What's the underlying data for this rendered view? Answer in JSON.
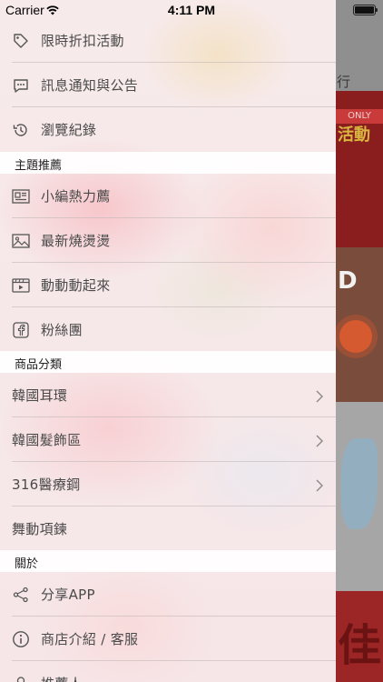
{
  "status_bar": {
    "carrier": "Carrier",
    "time": "4:11 PM"
  },
  "background": {
    "tab_fragment": "行",
    "banner_only": "ONLY",
    "banner_event": "活動",
    "banner_letter": "D",
    "banner_big_char": "佳"
  },
  "menu_top": [
    {
      "label": "限時折扣活動",
      "icon": "tag-icon"
    },
    {
      "label": "訊息通知與公告",
      "icon": "message-icon"
    },
    {
      "label": "瀏覽紀錄",
      "icon": "history-icon"
    }
  ],
  "section_themes": {
    "title": "主題推薦",
    "items": [
      {
        "label": "小編熱力薦",
        "icon": "newspaper-icon"
      },
      {
        "label": "最新燒燙燙",
        "icon": "image-icon"
      },
      {
        "label": "動動動起來",
        "icon": "video-icon"
      },
      {
        "label": "粉絲團",
        "icon": "facebook-icon"
      }
    ]
  },
  "section_categories": {
    "title": "商品分類",
    "items": [
      {
        "label": "韓國耳環",
        "has_chevron": true
      },
      {
        "label": "韓國髮飾區",
        "has_chevron": true
      },
      {
        "label": "316醫療鋼",
        "has_chevron": true
      },
      {
        "label": "舞動項鍊",
        "has_chevron": false
      }
    ]
  },
  "section_about": {
    "title": "關於",
    "items": [
      {
        "label": "分享APP",
        "icon": "share-icon"
      },
      {
        "label": "商店介紹 / 客服",
        "icon": "info-icon"
      },
      {
        "label": "推薦人",
        "icon": "person-icon"
      }
    ]
  }
}
